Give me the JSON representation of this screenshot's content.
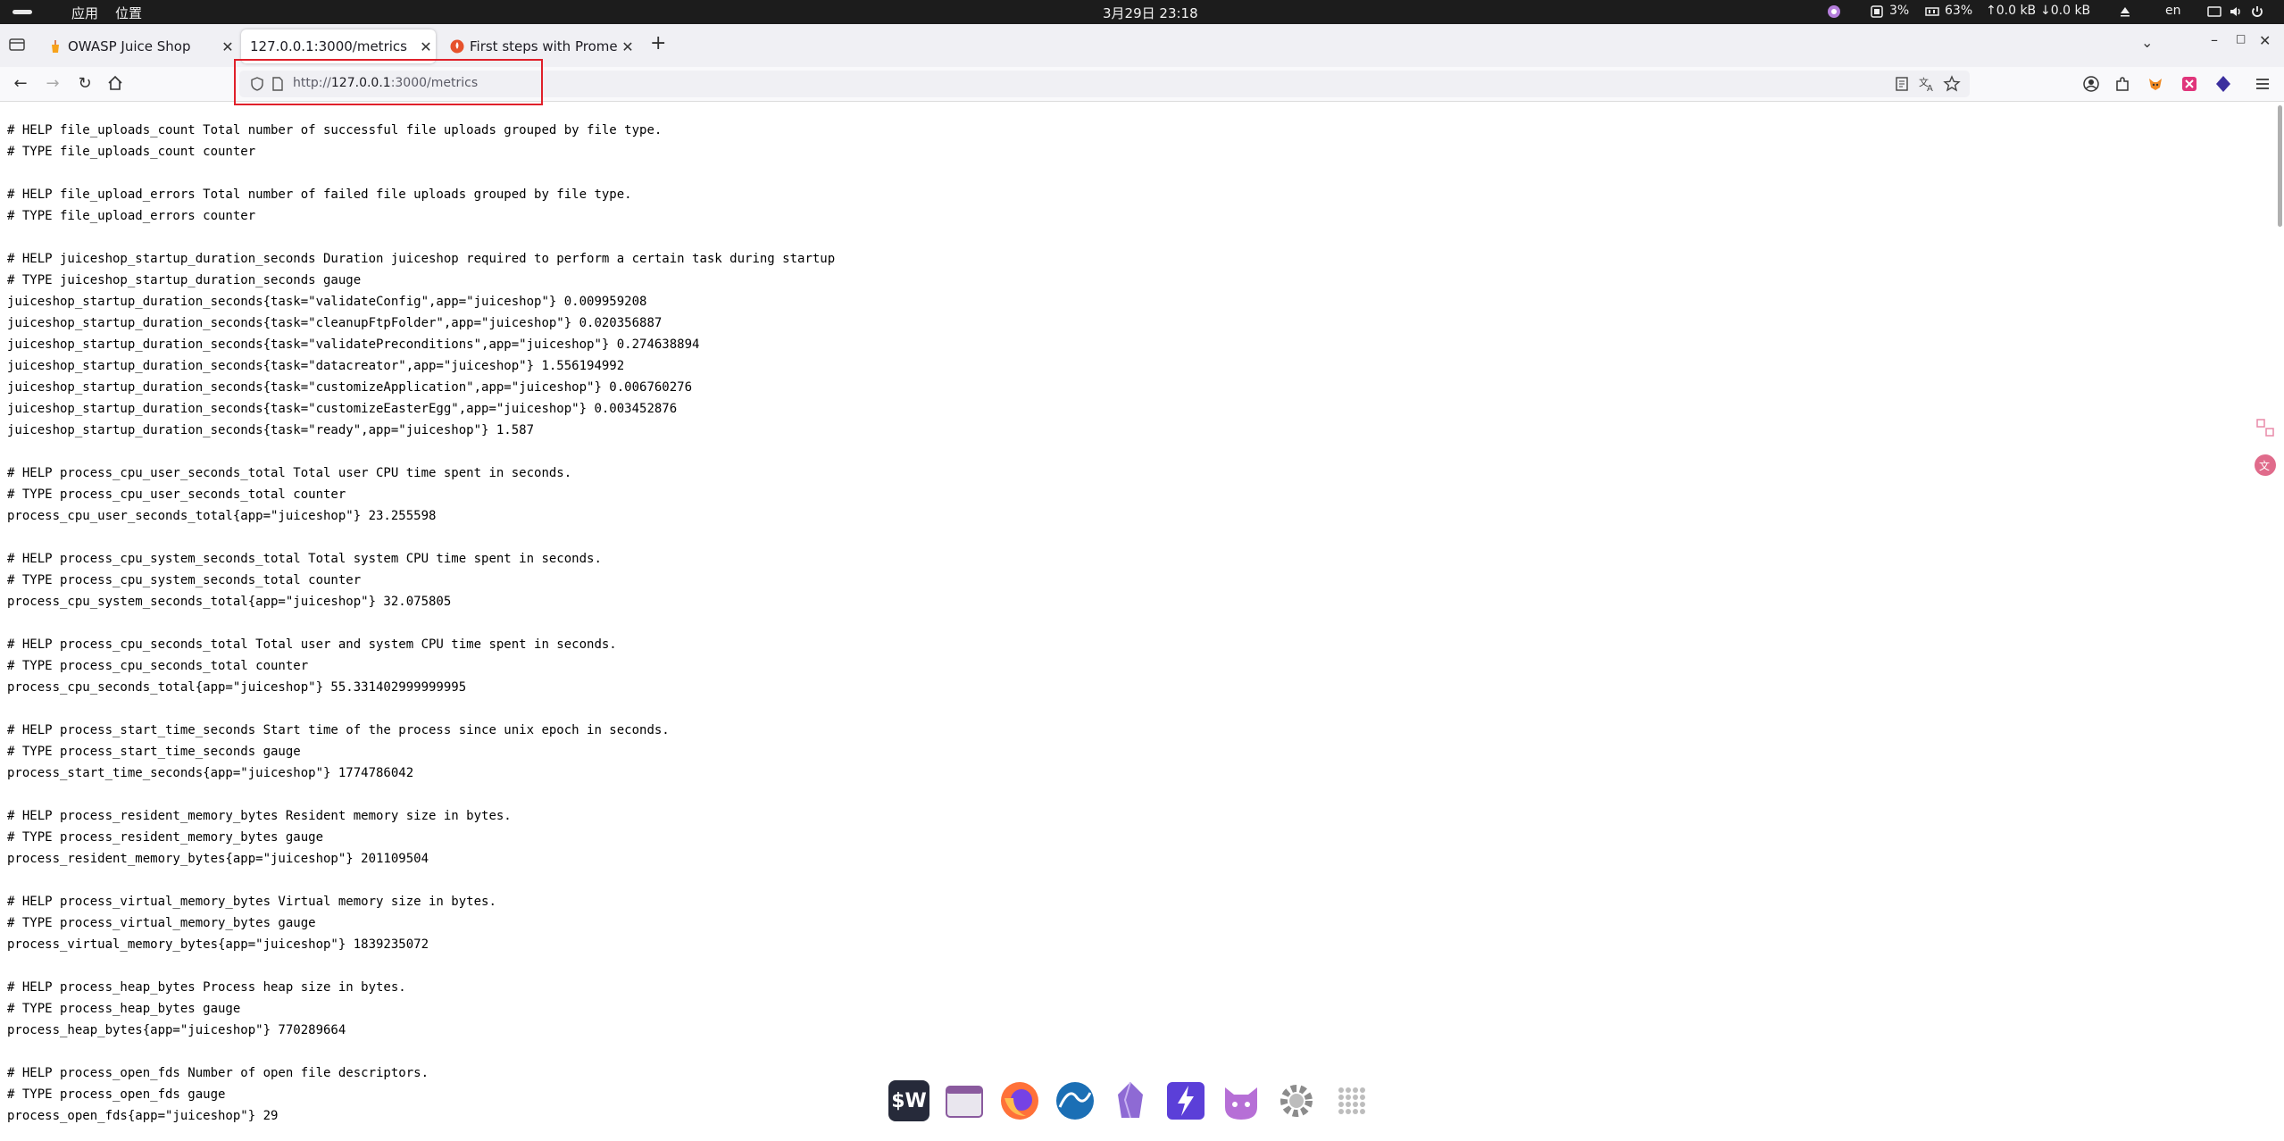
{
  "topbar": {
    "menu_apps": "应用",
    "menu_places": "位置",
    "clock": "3月29日  23:18",
    "cpu": "3%",
    "memory": "63%",
    "net_up": "↑0.0 kB",
    "net_down": "↓0.0 kB",
    "lang": "en"
  },
  "tabs": [
    {
      "title": "OWASP Juice Shop",
      "icon": "juice-shop-favicon",
      "active": false
    },
    {
      "title": "127.0.0.1:3000/metrics",
      "icon": "",
      "active": true
    },
    {
      "title": "First steps with Promethe",
      "icon": "prometheus-favicon",
      "active": false
    }
  ],
  "url": {
    "prefix": "http://",
    "host": "127.0.0.1",
    "path": ":3000/metrics"
  },
  "metrics_lines": [
    "# HELP file_uploads_count Total number of successful file uploads grouped by file type.",
    "# TYPE file_uploads_count counter",
    "",
    "# HELP file_upload_errors Total number of failed file uploads grouped by file type.",
    "# TYPE file_upload_errors counter",
    "",
    "# HELP juiceshop_startup_duration_seconds Duration juiceshop required to perform a certain task during startup",
    "# TYPE juiceshop_startup_duration_seconds gauge",
    "juiceshop_startup_duration_seconds{task=\"validateConfig\",app=\"juiceshop\"} 0.009959208",
    "juiceshop_startup_duration_seconds{task=\"cleanupFtpFolder\",app=\"juiceshop\"} 0.020356887",
    "juiceshop_startup_duration_seconds{task=\"validatePreconditions\",app=\"juiceshop\"} 0.274638894",
    "juiceshop_startup_duration_seconds{task=\"datacreator\",app=\"juiceshop\"} 1.556194992",
    "juiceshop_startup_duration_seconds{task=\"customizeApplication\",app=\"juiceshop\"} 0.006760276",
    "juiceshop_startup_duration_seconds{task=\"customizeEasterEgg\",app=\"juiceshop\"} 0.003452876",
    "juiceshop_startup_duration_seconds{task=\"ready\",app=\"juiceshop\"} 1.587",
    "",
    "# HELP process_cpu_user_seconds_total Total user CPU time spent in seconds.",
    "# TYPE process_cpu_user_seconds_total counter",
    "process_cpu_user_seconds_total{app=\"juiceshop\"} 23.255598",
    "",
    "# HELP process_cpu_system_seconds_total Total system CPU time spent in seconds.",
    "# TYPE process_cpu_system_seconds_total counter",
    "process_cpu_system_seconds_total{app=\"juiceshop\"} 32.075805",
    "",
    "# HELP process_cpu_seconds_total Total user and system CPU time spent in seconds.",
    "# TYPE process_cpu_seconds_total counter",
    "process_cpu_seconds_total{app=\"juiceshop\"} 55.331402999999995",
    "",
    "# HELP process_start_time_seconds Start time of the process since unix epoch in seconds.",
    "# TYPE process_start_time_seconds gauge",
    "process_start_time_seconds{app=\"juiceshop\"} 1774786042",
    "",
    "# HELP process_resident_memory_bytes Resident memory size in bytes.",
    "# TYPE process_resident_memory_bytes gauge",
    "process_resident_memory_bytes{app=\"juiceshop\"} 201109504",
    "",
    "# HELP process_virtual_memory_bytes Virtual memory size in bytes.",
    "# TYPE process_virtual_memory_bytes gauge",
    "process_virtual_memory_bytes{app=\"juiceshop\"} 1839235072",
    "",
    "# HELP process_heap_bytes Process heap size in bytes.",
    "# TYPE process_heap_bytes gauge",
    "process_heap_bytes{app=\"juiceshop\"} 770289664",
    "",
    "# HELP process_open_fds Number of open file descriptors.",
    "# TYPE process_open_fds gauge",
    "process_open_fds{app=\"juiceshop\"} 29"
  ],
  "dock_apps": [
    {
      "name": "wps-app-icon",
      "label": "$W"
    },
    {
      "name": "files-app-icon",
      "label": ""
    },
    {
      "name": "firefox-app-icon",
      "label": ""
    },
    {
      "name": "wireshark-app-icon",
      "label": ""
    },
    {
      "name": "obsidian-app-icon",
      "label": ""
    },
    {
      "name": "zap-app-icon",
      "label": ""
    },
    {
      "name": "cat-app-icon",
      "label": ""
    },
    {
      "name": "settings-app-icon",
      "label": ""
    },
    {
      "name": "app-grid-icon",
      "label": ""
    }
  ],
  "colors": {
    "highlight_border": "#e0202a",
    "topbar_bg": "#1c1c1c",
    "tabstrip_bg": "#f0f0f4"
  }
}
